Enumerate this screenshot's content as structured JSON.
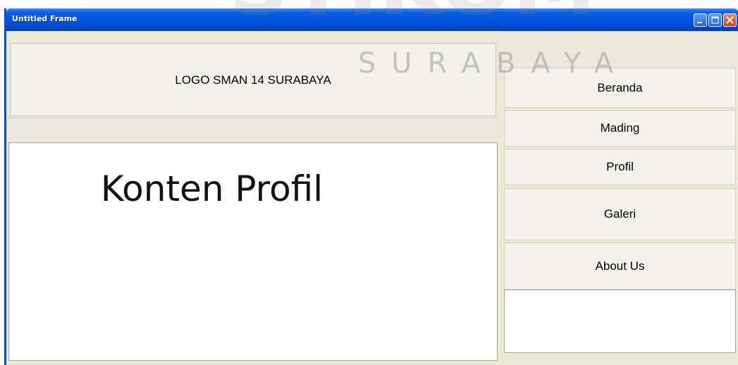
{
  "window": {
    "title": "Untitled Frame",
    "controls": [
      "minimize-icon",
      "maximize-icon",
      "close-icon"
    ],
    "colors": {
      "titlebar": "#0454e0",
      "close": "#c8431f"
    }
  },
  "header": {
    "logo_text": "LOGO SMAN 14 SURABAYA"
  },
  "main": {
    "heading": "Konten Profil"
  },
  "sidebar": {
    "items": [
      {
        "label": "Beranda"
      },
      {
        "label": "Mading"
      },
      {
        "label": "Profil"
      },
      {
        "label": "Galeri"
      },
      {
        "label": "About Us"
      }
    ]
  },
  "watermark": {
    "top_text": "STIKOM",
    "sub_text": "SURABAYA"
  }
}
